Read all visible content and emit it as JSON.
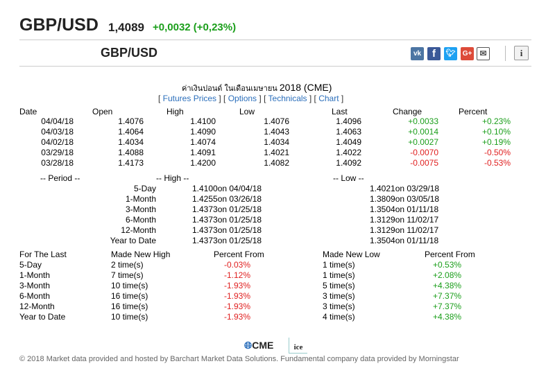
{
  "header": {
    "pair": "GBP/USD",
    "price": "1,4089",
    "change": "+0,0032 (+0,23%)"
  },
  "widget": {
    "pair": "GBP/USD",
    "social": [
      "vk-icon",
      "facebook-icon",
      "twitter-icon",
      "google-plus-icon",
      "mail-icon",
      "info-icon"
    ],
    "title_thai": "ค่าเงินปอนด์ ในเดือนเมษายน",
    "title_suffix": "2018 (CME)",
    "links": {
      "futures": "Futures Prices",
      "options": "Options",
      "technicals": "Technicals",
      "chart": "Chart"
    },
    "table": {
      "headers": [
        "Date",
        "Open",
        "High",
        "Low",
        "Last",
        "Change",
        "Percent"
      ],
      "rows": [
        {
          "date": "04/04/18",
          "open": "1.4076",
          "high": "1.4100",
          "low": "1.4076",
          "last": "1.4096",
          "change": "+0.0033",
          "percent": "+0.23%",
          "dir": "up"
        },
        {
          "date": "04/03/18",
          "open": "1.4064",
          "high": "1.4090",
          "low": "1.4043",
          "last": "1.4063",
          "change": "+0.0014",
          "percent": "+0.10%",
          "dir": "up"
        },
        {
          "date": "04/02/18",
          "open": "1.4034",
          "high": "1.4074",
          "low": "1.4034",
          "last": "1.4049",
          "change": "+0.0027",
          "percent": "+0.19%",
          "dir": "up"
        },
        {
          "date": "03/29/18",
          "open": "1.4088",
          "high": "1.4091",
          "low": "1.4021",
          "last": "1.4022",
          "change": "-0.0070",
          "percent": "-0.50%",
          "dir": "down"
        },
        {
          "date": "03/28/18",
          "open": "1.4173",
          "high": "1.4200",
          "low": "1.4082",
          "last": "1.4092",
          "change": "-0.0075",
          "percent": "-0.53%",
          "dir": "down"
        }
      ]
    },
    "period": {
      "label": "-- Period --",
      "high_label": "-- High --",
      "low_label": "-- Low --",
      "rows": [
        {
          "period": "5-Day",
          "high": "1.4100on 04/04/18",
          "low": "1.4021on 03/29/18"
        },
        {
          "period": "1-Month",
          "high": "1.4255on 03/26/18",
          "low": "1.3809on 03/05/18"
        },
        {
          "period": "3-Month",
          "high": "1.4373on 01/25/18",
          "low": "1.3504on 01/11/18"
        },
        {
          "period": "6-Month",
          "high": "1.4373on 01/25/18",
          "low": "1.3129on 11/02/17"
        },
        {
          "period": "12-Month",
          "high": "1.4373on 01/25/18",
          "low": "1.3129on 11/02/17"
        },
        {
          "period": "Year to Date",
          "high": "1.4373on 01/25/18",
          "low": "1.3504on 01/11/18"
        }
      ]
    },
    "last": {
      "headers": [
        "For The Last",
        "Made New High",
        "Percent From",
        "Made New Low",
        "Percent From"
      ],
      "rows": [
        {
          "period": "5-Day",
          "new_high": "2 time(s)",
          "high_pct": "-0.03%",
          "new_low": "1 time(s)",
          "low_pct": "+0.53%"
        },
        {
          "period": "1-Month",
          "new_high": "7 time(s)",
          "high_pct": "-1.12%",
          "new_low": "1 time(s)",
          "low_pct": "+2.08%"
        },
        {
          "period": "3-Month",
          "new_high": "10 time(s)",
          "high_pct": "-1.93%",
          "new_low": "5 time(s)",
          "low_pct": "+4.38%"
        },
        {
          "period": "6-Month",
          "new_high": "16 time(s)",
          "high_pct": "-1.93%",
          "new_low": "3 time(s)",
          "low_pct": "+7.37%"
        },
        {
          "period": "12-Month",
          "new_high": "16 time(s)",
          "high_pct": "-1.93%",
          "new_low": "3 time(s)",
          "low_pct": "+7.37%"
        },
        {
          "period": "Year to Date",
          "new_high": "10 time(s)",
          "high_pct": "-1.93%",
          "new_low": "4 time(s)",
          "low_pct": "+4.38%"
        }
      ]
    },
    "logos": {
      "cme": "CME",
      "ice": "ice"
    },
    "footer": "© 2018 Market data provided and hosted by Barchart Market Data Solutions. Fundamental company data provided by Morningstar"
  },
  "colors": {
    "up": "#1a9e1a",
    "down": "#e02020",
    "link": "#2a6ebb"
  }
}
